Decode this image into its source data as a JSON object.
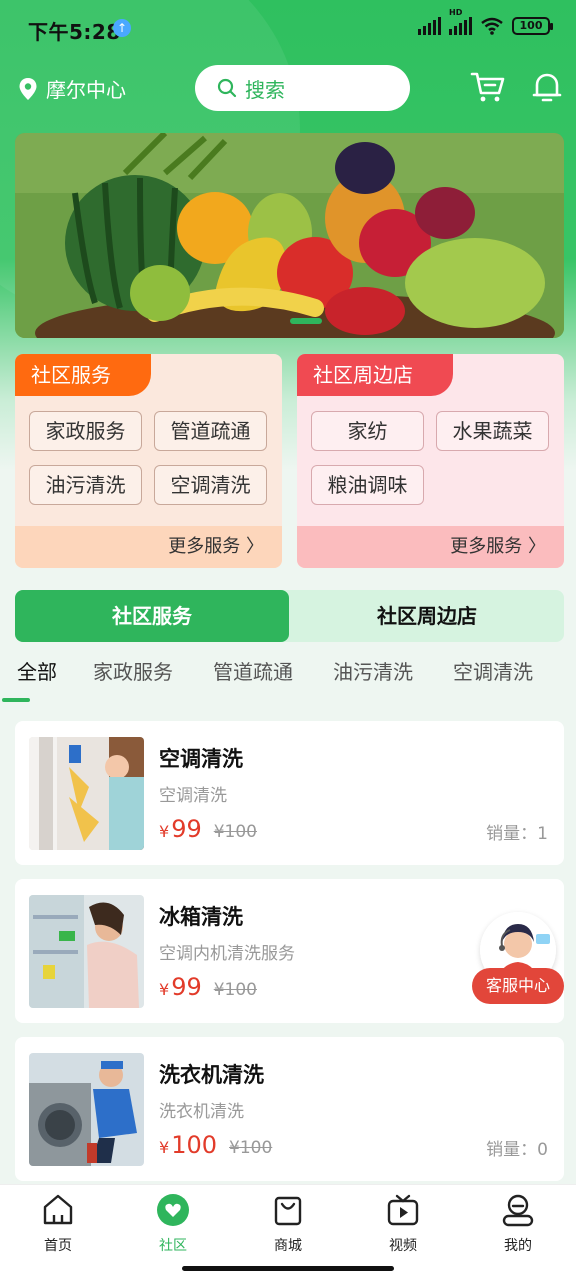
{
  "status_bar": {
    "time": "下午5:28",
    "battery": "100",
    "net": "HD"
  },
  "header": {
    "location": "摩尔中心",
    "search_placeholder": "搜索"
  },
  "cards": [
    {
      "title": "社区服务",
      "chips": [
        "家政服务",
        "管道疏通",
        "油污清洗",
        "空调清洗"
      ],
      "more": "更多服务 〉"
    },
    {
      "title": "社区周边店",
      "chips": [
        "家纺",
        "水果蔬菜",
        "粮油调味"
      ],
      "more": "更多服务 〉"
    }
  ],
  "switch": {
    "active": "社区服务",
    "inactive": "社区周边店"
  },
  "categories": [
    "全部",
    "家政服务",
    "管道疏通",
    "油污清洗",
    "空调清洗"
  ],
  "items": [
    {
      "title": "空调清洗",
      "subtitle": "空调清洗",
      "currency": "¥",
      "price": "99",
      "old_price": "¥100",
      "sales": "销量：1"
    },
    {
      "title": "冰箱清洗",
      "subtitle": "空调内机清洗服务",
      "currency": "¥",
      "price": "99",
      "old_price": "¥100",
      "sales": ""
    },
    {
      "title": "洗衣机清洗",
      "subtitle": "洗衣机清洗",
      "currency": "¥",
      "price": "100",
      "old_price": "¥100",
      "sales": "销量：0"
    }
  ],
  "customer_service": "客服中心",
  "tabbar": [
    {
      "label": "首页",
      "icon": "home-icon"
    },
    {
      "label": "社区",
      "icon": "community-icon"
    },
    {
      "label": "商城",
      "icon": "shopping-bag-icon"
    },
    {
      "label": "视频",
      "icon": "video-icon"
    },
    {
      "label": "我的",
      "icon": "profile-icon"
    }
  ],
  "colors": {
    "brand": "#2fb55c",
    "price": "#e23b2a",
    "orange": "#ff6a10",
    "red": "#f04a52"
  }
}
